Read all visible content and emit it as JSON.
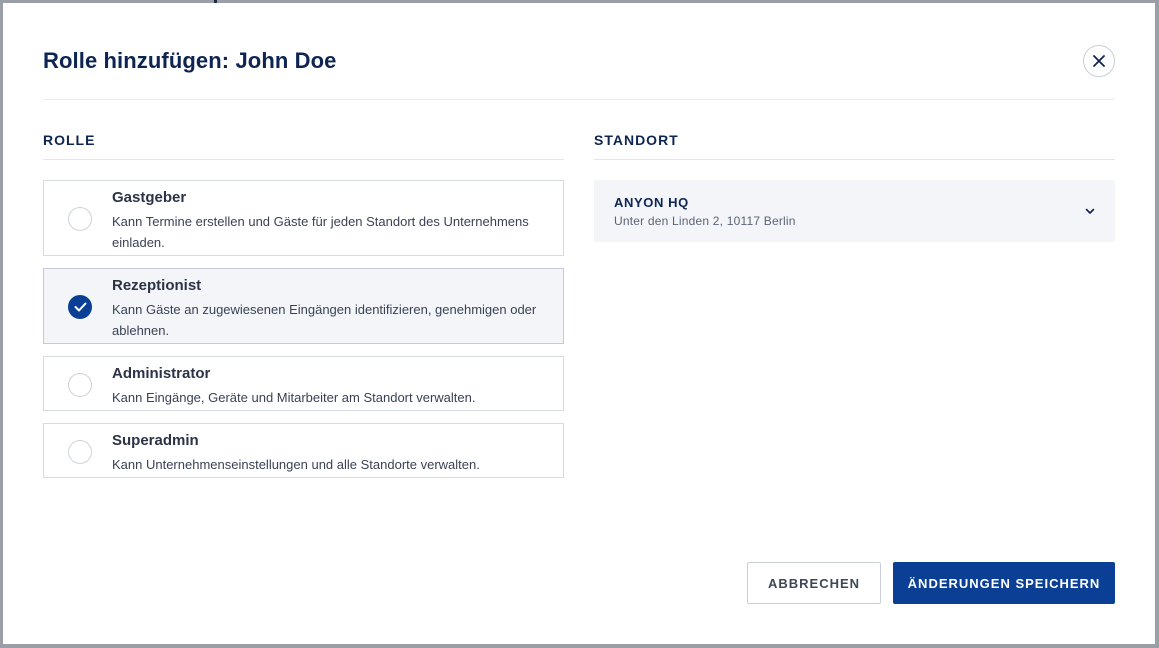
{
  "modal": {
    "title": "Rolle hinzufügen: John Doe"
  },
  "role_section": {
    "label": "ROLLE",
    "roles": [
      {
        "title": "Gastgeber",
        "description": "Kann Termine erstellen und Gäste für jeden Standort des Unternehmens einladen.",
        "selected": false
      },
      {
        "title": "Rezeptionist",
        "description": "Kann Gäste an zugewiesenen Eingängen identifizieren, genehmigen oder ablehnen.",
        "selected": true
      },
      {
        "title": "Administrator",
        "description": "Kann Eingänge, Geräte und Mitarbeiter am Standort verwalten.",
        "selected": false
      },
      {
        "title": "Superadmin",
        "description": "Kann Unternehmenseinstellungen und alle Standorte verwalten.",
        "selected": false
      }
    ]
  },
  "location_section": {
    "label": "STANDORT",
    "selected": {
      "name": "ANYON HQ",
      "address": "Unter den Linden 2, 10117 Berlin"
    }
  },
  "footer": {
    "cancel_label": "ABBRECHEN",
    "save_label": "ÄNDERUNGEN SPEICHERN"
  },
  "colors": {
    "primary": "#0b3f95",
    "heading": "#0e2554",
    "selected_bg": "#f4f5f9"
  },
  "icons": {
    "close": "close-icon",
    "check": "check-icon",
    "chevron": "chevron-down-icon"
  }
}
